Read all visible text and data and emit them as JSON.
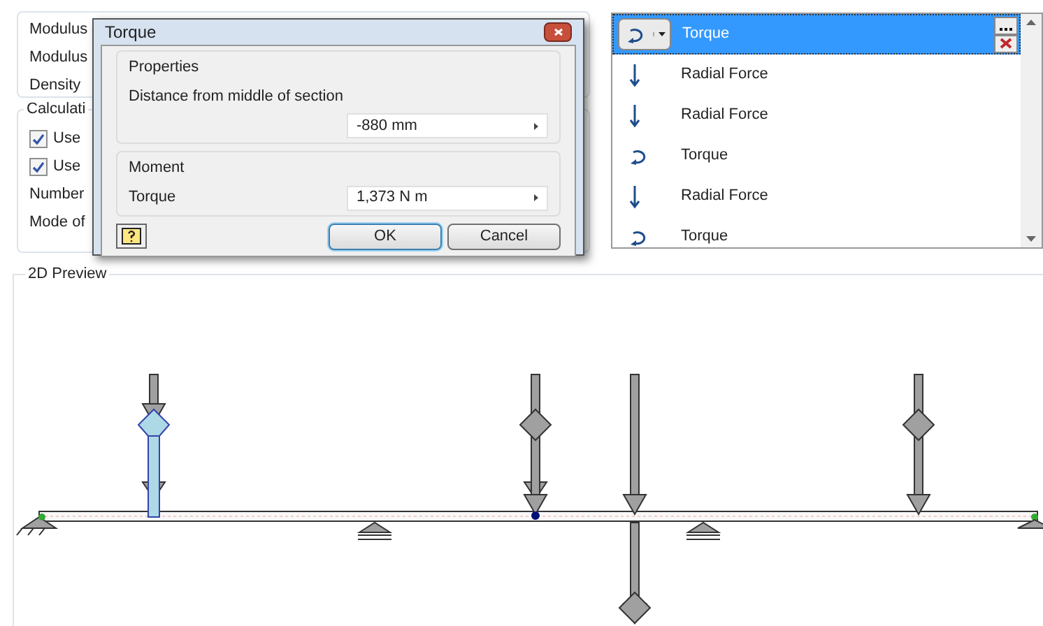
{
  "material_rows": [
    {
      "label": "Modulus"
    },
    {
      "label": "Modulus"
    },
    {
      "label": "Density"
    }
  ],
  "calculation": {
    "title": "Calculati",
    "options": [
      {
        "kind": "checkbox",
        "label": "Use",
        "checked": true
      },
      {
        "kind": "checkbox",
        "label": "Use",
        "checked": true
      },
      {
        "kind": "text",
        "label": "Number"
      },
      {
        "kind": "text",
        "label": "Mode of"
      }
    ]
  },
  "loads": [
    {
      "kind": "torque",
      "label": "Torque",
      "selected": true
    },
    {
      "kind": "force",
      "label": "Radial Force",
      "selected": false
    },
    {
      "kind": "force",
      "label": "Radial Force",
      "selected": false
    },
    {
      "kind": "torque",
      "label": "Torque",
      "selected": false
    },
    {
      "kind": "force",
      "label": "Radial Force",
      "selected": false
    },
    {
      "kind": "torque",
      "label": "Torque",
      "selected": false
    }
  ],
  "dialog": {
    "title": "Torque",
    "groups": [
      {
        "title": "Properties",
        "label": "Distance from middle of section",
        "value": "-880 mm",
        "kind": "stacked"
      },
      {
        "title": "Moment",
        "label": "Torque",
        "value": "1,373 N m",
        "kind": "inline"
      }
    ],
    "buttons": [
      {
        "label": "OK",
        "default": true
      },
      {
        "label": "Cancel",
        "default": false
      }
    ]
  },
  "preview": {
    "title": "2D Preview"
  }
}
